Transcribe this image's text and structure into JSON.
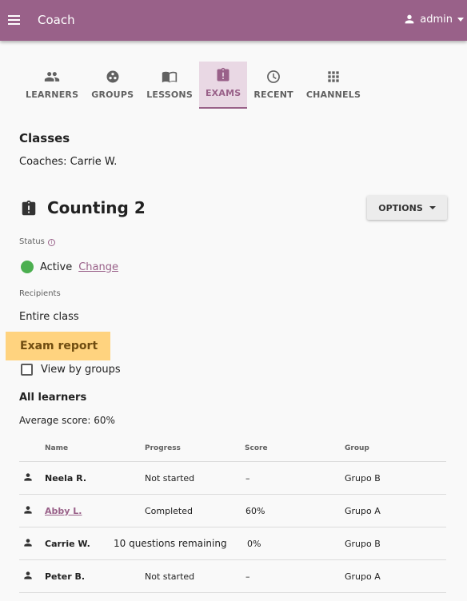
{
  "appbar": {
    "title": "Coach",
    "user": "admin"
  },
  "colors": {
    "brand": "#996189",
    "active_status": "#4caf50",
    "highlight": "#ffd37f"
  },
  "tabs": [
    {
      "label": "LEARNERS",
      "icon": "people-icon",
      "active": false
    },
    {
      "label": "GROUPS",
      "icon": "groups-icon",
      "active": false
    },
    {
      "label": "LESSONS",
      "icon": "book-icon",
      "active": false
    },
    {
      "label": "EXAMS",
      "icon": "clipboard-icon",
      "active": true
    },
    {
      "label": "RECENT",
      "icon": "clock-icon",
      "active": false
    },
    {
      "label": "CHANNELS",
      "icon": "grid-icon",
      "active": false
    }
  ],
  "classes": {
    "heading": "Classes",
    "coaches": "Coaches: Carrie W."
  },
  "exam": {
    "title": "Counting 2",
    "options_label": "OPTIONS",
    "status_label": "Status",
    "status_value": "Active",
    "change_label": "Change",
    "recipients_label": "Recipients",
    "recipients_value": "Entire class",
    "report_label": "Exam report",
    "view_by_groups": "View by groups",
    "all_learners": "All learners",
    "average_score": "Average score: 60%"
  },
  "table": {
    "headers": {
      "name": "Name",
      "progress": "Progress",
      "score": "Score",
      "group": "Group"
    },
    "rows": [
      {
        "name": "Neela R.",
        "progress": "Not started",
        "score": "–",
        "group": "Grupo B",
        "link": false
      },
      {
        "name": "Abby L.",
        "progress": "Completed",
        "score": "60%",
        "group": "Grupo A",
        "link": true
      },
      {
        "name": "Carrie W.",
        "progress": "10 questions remaining",
        "score": "0%",
        "group": "Grupo B",
        "link": false
      },
      {
        "name": "Peter B.",
        "progress": "Not started",
        "score": "–",
        "group": "Grupo A",
        "link": false
      }
    ]
  }
}
